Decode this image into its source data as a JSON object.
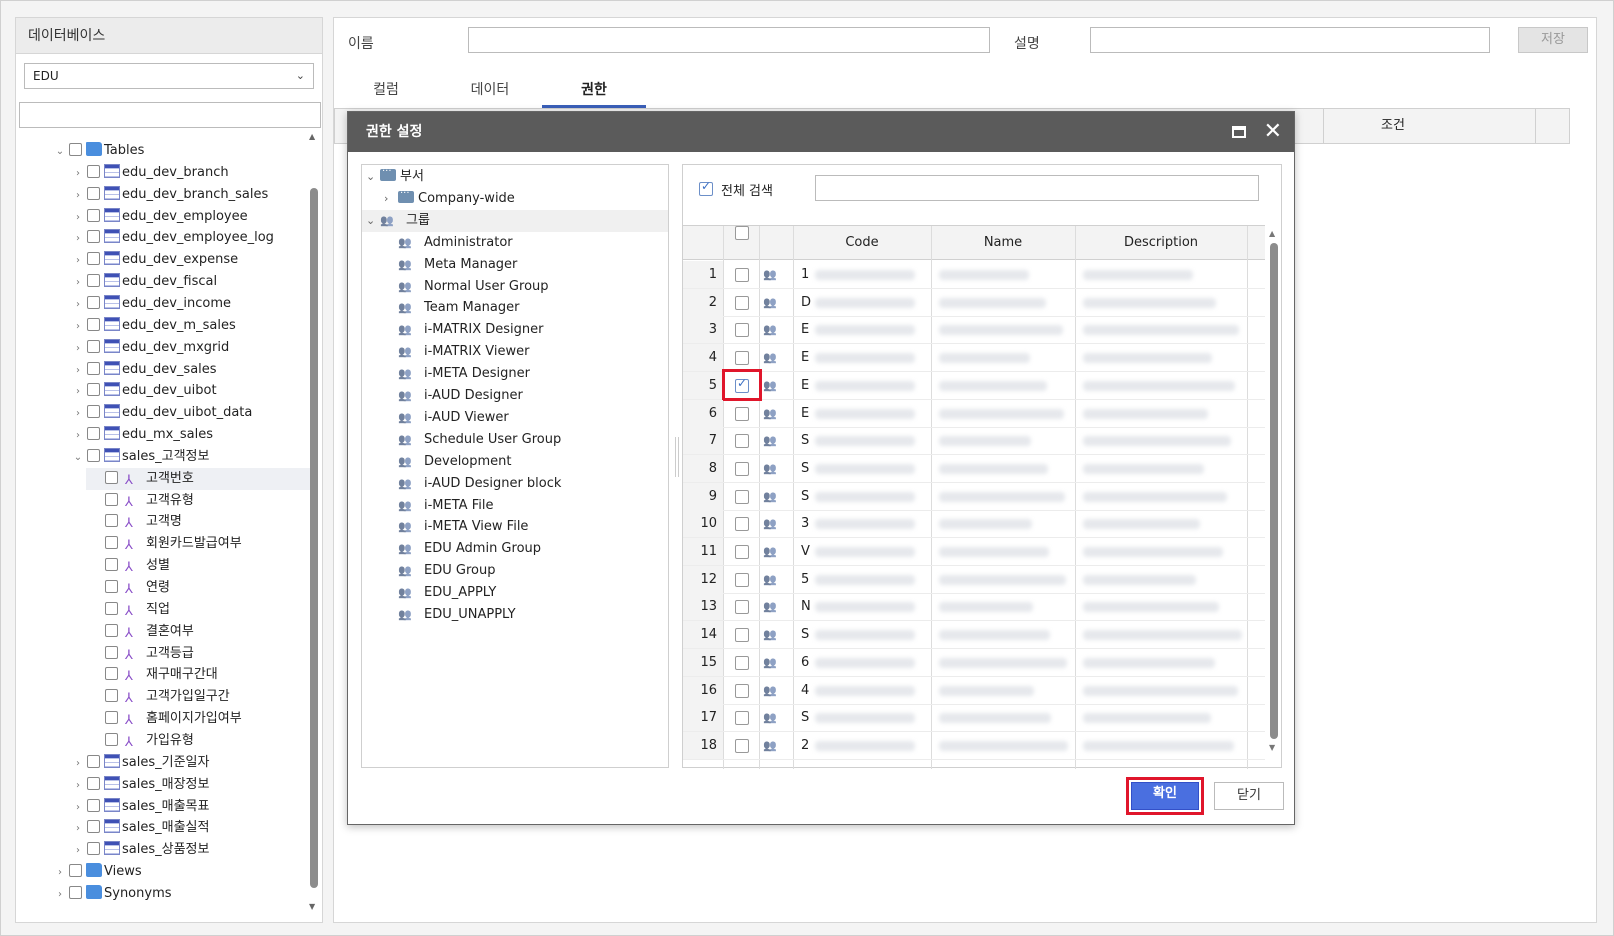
{
  "left_panel": {
    "title": "데이터베이스",
    "db_select": "EDU",
    "tree": [
      {
        "level": 0,
        "exp": "v",
        "cb": true,
        "icon": "folder",
        "label": "Tables"
      },
      {
        "level": 1,
        "exp": ">",
        "cb": true,
        "icon": "table",
        "label": "edu_dev_branch"
      },
      {
        "level": 1,
        "exp": ">",
        "cb": true,
        "icon": "table",
        "label": "edu_dev_branch_sales"
      },
      {
        "level": 1,
        "exp": ">",
        "cb": true,
        "icon": "table",
        "label": "edu_dev_employee"
      },
      {
        "level": 1,
        "exp": ">",
        "cb": true,
        "icon": "table",
        "label": "edu_dev_employee_log"
      },
      {
        "level": 1,
        "exp": ">",
        "cb": true,
        "icon": "table",
        "label": "edu_dev_expense"
      },
      {
        "level": 1,
        "exp": ">",
        "cb": true,
        "icon": "table",
        "label": "edu_dev_fiscal"
      },
      {
        "level": 1,
        "exp": ">",
        "cb": true,
        "icon": "table",
        "label": "edu_dev_income"
      },
      {
        "level": 1,
        "exp": ">",
        "cb": true,
        "icon": "table",
        "label": "edu_dev_m_sales"
      },
      {
        "level": 1,
        "exp": ">",
        "cb": true,
        "icon": "table",
        "label": "edu_dev_mxgrid"
      },
      {
        "level": 1,
        "exp": ">",
        "cb": true,
        "icon": "table",
        "label": "edu_dev_sales"
      },
      {
        "level": 1,
        "exp": ">",
        "cb": true,
        "icon": "table",
        "label": "edu_dev_uibot"
      },
      {
        "level": 1,
        "exp": ">",
        "cb": true,
        "icon": "table",
        "label": "edu_dev_uibot_data"
      },
      {
        "level": 1,
        "exp": ">",
        "cb": true,
        "icon": "table",
        "label": "edu_mx_sales"
      },
      {
        "level": 1,
        "exp": "v",
        "cb": true,
        "icon": "table",
        "label": "sales_고객정보"
      },
      {
        "level": 2,
        "exp": "",
        "cb": true,
        "icon": "column",
        "label": "고객번호",
        "selected": true
      },
      {
        "level": 2,
        "exp": "",
        "cb": true,
        "icon": "column",
        "label": "고객유형"
      },
      {
        "level": 2,
        "exp": "",
        "cb": true,
        "icon": "column",
        "label": "고객명"
      },
      {
        "level": 2,
        "exp": "",
        "cb": true,
        "icon": "column",
        "label": "회원카드발급여부"
      },
      {
        "level": 2,
        "exp": "",
        "cb": true,
        "icon": "column",
        "label": "성별"
      },
      {
        "level": 2,
        "exp": "",
        "cb": true,
        "icon": "column",
        "label": "연령"
      },
      {
        "level": 2,
        "exp": "",
        "cb": true,
        "icon": "column",
        "label": "직업"
      },
      {
        "level": 2,
        "exp": "",
        "cb": true,
        "icon": "column",
        "label": "결혼여부"
      },
      {
        "level": 2,
        "exp": "",
        "cb": true,
        "icon": "column",
        "label": "고객등급"
      },
      {
        "level": 2,
        "exp": "",
        "cb": true,
        "icon": "column",
        "label": "재구매구간대"
      },
      {
        "level": 2,
        "exp": "",
        "cb": true,
        "icon": "column",
        "label": "고객가입일구간"
      },
      {
        "level": 2,
        "exp": "",
        "cb": true,
        "icon": "column",
        "label": "홈페이지가입여부"
      },
      {
        "level": 2,
        "exp": "",
        "cb": true,
        "icon": "column",
        "label": "가입유형"
      },
      {
        "level": 1,
        "exp": ">",
        "cb": true,
        "icon": "table",
        "label": "sales_기준일자"
      },
      {
        "level": 1,
        "exp": ">",
        "cb": true,
        "icon": "table",
        "label": "sales_매장정보"
      },
      {
        "level": 1,
        "exp": ">",
        "cb": true,
        "icon": "table",
        "label": "sales_매출목표"
      },
      {
        "level": 1,
        "exp": ">",
        "cb": true,
        "icon": "table",
        "label": "sales_매출실적"
      },
      {
        "level": 1,
        "exp": ">",
        "cb": true,
        "icon": "table",
        "label": "sales_상품정보"
      },
      {
        "level": 0,
        "exp": ">",
        "cb": true,
        "icon": "folder",
        "label": "Views"
      },
      {
        "level": 0,
        "exp": ">",
        "cb": true,
        "icon": "folder",
        "label": "Synonyms"
      }
    ]
  },
  "header": {
    "name_label": "이름",
    "desc_label": "설명",
    "save_label": "저장"
  },
  "tabs": [
    "컬럼",
    "데이터",
    "권한"
  ],
  "grid": {
    "condition_header": "조건"
  },
  "dialog": {
    "title": "권한 설정",
    "tree": [
      {
        "level": 0,
        "exp": "v",
        "icon": "dept",
        "label": "부서"
      },
      {
        "level": 1,
        "exp": ">",
        "icon": "dept",
        "label": "Company-wide"
      },
      {
        "level": 0,
        "exp": "v",
        "icon": "group",
        "label": "그룹",
        "selected": true
      },
      {
        "level": 1,
        "exp": "",
        "icon": "group",
        "label": "Administrator"
      },
      {
        "level": 1,
        "exp": "",
        "icon": "group",
        "label": "Meta Manager"
      },
      {
        "level": 1,
        "exp": "",
        "icon": "group",
        "label": "Normal User Group"
      },
      {
        "level": 1,
        "exp": "",
        "icon": "group",
        "label": "Team Manager"
      },
      {
        "level": 1,
        "exp": "",
        "icon": "group",
        "label": "i-MATRIX Designer"
      },
      {
        "level": 1,
        "exp": "",
        "icon": "group",
        "label": "i-MATRIX Viewer"
      },
      {
        "level": 1,
        "exp": "",
        "icon": "group",
        "label": "i-META Designer"
      },
      {
        "level": 1,
        "exp": "",
        "icon": "group",
        "label": "i-AUD Designer"
      },
      {
        "level": 1,
        "exp": "",
        "icon": "group",
        "label": "i-AUD Viewer"
      },
      {
        "level": 1,
        "exp": "",
        "icon": "group",
        "label": "Schedule User Group"
      },
      {
        "level": 1,
        "exp": "",
        "icon": "group",
        "label": "Development"
      },
      {
        "level": 1,
        "exp": "",
        "icon": "group",
        "label": "i-AUD Designer block"
      },
      {
        "level": 1,
        "exp": "",
        "icon": "group",
        "label": "i-META File"
      },
      {
        "level": 1,
        "exp": "",
        "icon": "group",
        "label": "i-META View File"
      },
      {
        "level": 1,
        "exp": "",
        "icon": "group",
        "label": "EDU Admin Group"
      },
      {
        "level": 1,
        "exp": "",
        "icon": "group",
        "label": "EDU Group"
      },
      {
        "level": 1,
        "exp": "",
        "icon": "group",
        "label": "EDU_APPLY"
      },
      {
        "level": 1,
        "exp": "",
        "icon": "group",
        "label": "EDU_UNAPPLY"
      }
    ],
    "search_all_label": "전체 검색",
    "search_all_checked": true,
    "columns": [
      "Code",
      "Name",
      "Description"
    ],
    "rows": [
      {
        "num": "1",
        "code": "1",
        "checked": false
      },
      {
        "num": "2",
        "code": "D",
        "checked": false
      },
      {
        "num": "3",
        "code": "E",
        "checked": false
      },
      {
        "num": "4",
        "code": "E",
        "checked": false
      },
      {
        "num": "5",
        "code": "E",
        "checked": true
      },
      {
        "num": "6",
        "code": "E",
        "checked": false
      },
      {
        "num": "7",
        "code": "S",
        "checked": false
      },
      {
        "num": "8",
        "code": "S",
        "checked": false
      },
      {
        "num": "9",
        "code": "S",
        "checked": false
      },
      {
        "num": "10",
        "code": "3",
        "checked": false
      },
      {
        "num": "11",
        "code": "V",
        "checked": false
      },
      {
        "num": "12",
        "code": "5",
        "checked": false
      },
      {
        "num": "13",
        "code": "N",
        "checked": false
      },
      {
        "num": "14",
        "code": "S",
        "checked": false
      },
      {
        "num": "15",
        "code": "6",
        "checked": false
      },
      {
        "num": "16",
        "code": "4",
        "checked": false
      },
      {
        "num": "17",
        "code": "S",
        "checked": false
      },
      {
        "num": "18",
        "code": "2",
        "checked": false
      }
    ],
    "ok_label": "확인",
    "close_label": "닫기"
  },
  "colors": {
    "accent": "#4a6fe0",
    "highlight": "#e0162b",
    "title_bar": "#5b5b5b",
    "tab_underline": "#3a5fb8"
  }
}
